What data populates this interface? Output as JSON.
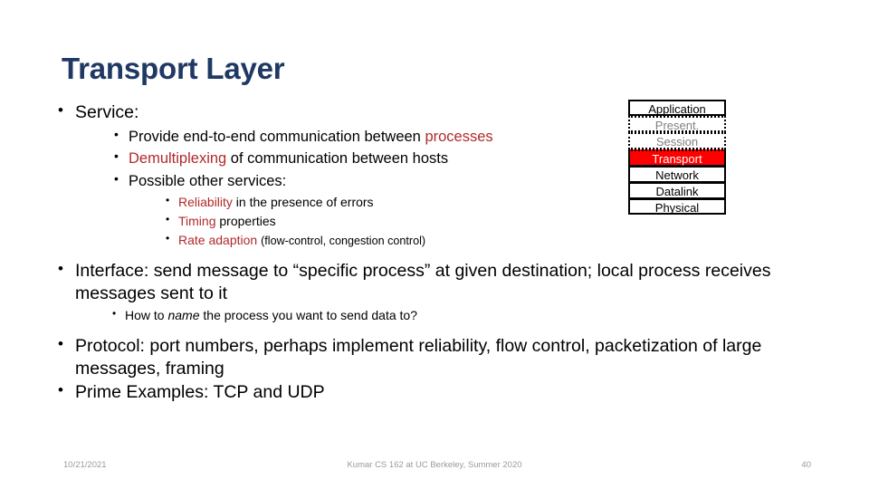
{
  "slide": {
    "title": "Transport Layer",
    "title_color": "#1F3864",
    "accent_red": "#B02A2A",
    "highlight_red": "#FF0000"
  },
  "content": {
    "service": {
      "label": "Service:",
      "items": [
        {
          "pre": "Provide end-to-end communication between ",
          "red": "processes",
          "post": ""
        },
        {
          "pre": "",
          "red": "Demultiplexing",
          "post": " of communication between hosts"
        },
        {
          "pre": "Possible other services:",
          "red": "",
          "post": ""
        }
      ],
      "sub_items": [
        {
          "red": "Reliability",
          "post": " in the presence of errors",
          "paren": ""
        },
        {
          "red": "Timing",
          "post": " properties",
          "paren": ""
        },
        {
          "red": "Rate adaption",
          "post": " ",
          "paren": "(flow-control, congestion control)"
        }
      ]
    },
    "interface": {
      "text": "Interface: send message to “specific process” at given destination; local process receives messages sent to it",
      "sub": {
        "pre": "How to ",
        "italic": "name",
        "post": " the process you want to send data to?"
      }
    },
    "protocol": {
      "text": "Protocol: port numbers, perhaps implement reliability, flow control, packetization of large messages, framing"
    },
    "examples": {
      "text": "Prime Examples: TCP and UDP"
    }
  },
  "osi_stack": {
    "layers": [
      {
        "label": "Application",
        "style": "solid"
      },
      {
        "label": "Present.",
        "style": "dotted"
      },
      {
        "label": "Session",
        "style": "dotted"
      },
      {
        "label": "Transport",
        "style": "highlight"
      },
      {
        "label": "Network",
        "style": "solid"
      },
      {
        "label": "Datalink",
        "style": "solid"
      },
      {
        "label": "Physical",
        "style": "solid"
      }
    ]
  },
  "footer": {
    "date": "10/21/2021",
    "center": "Kumar CS 162 at UC Berkeley, Summer 2020",
    "page": "40"
  }
}
